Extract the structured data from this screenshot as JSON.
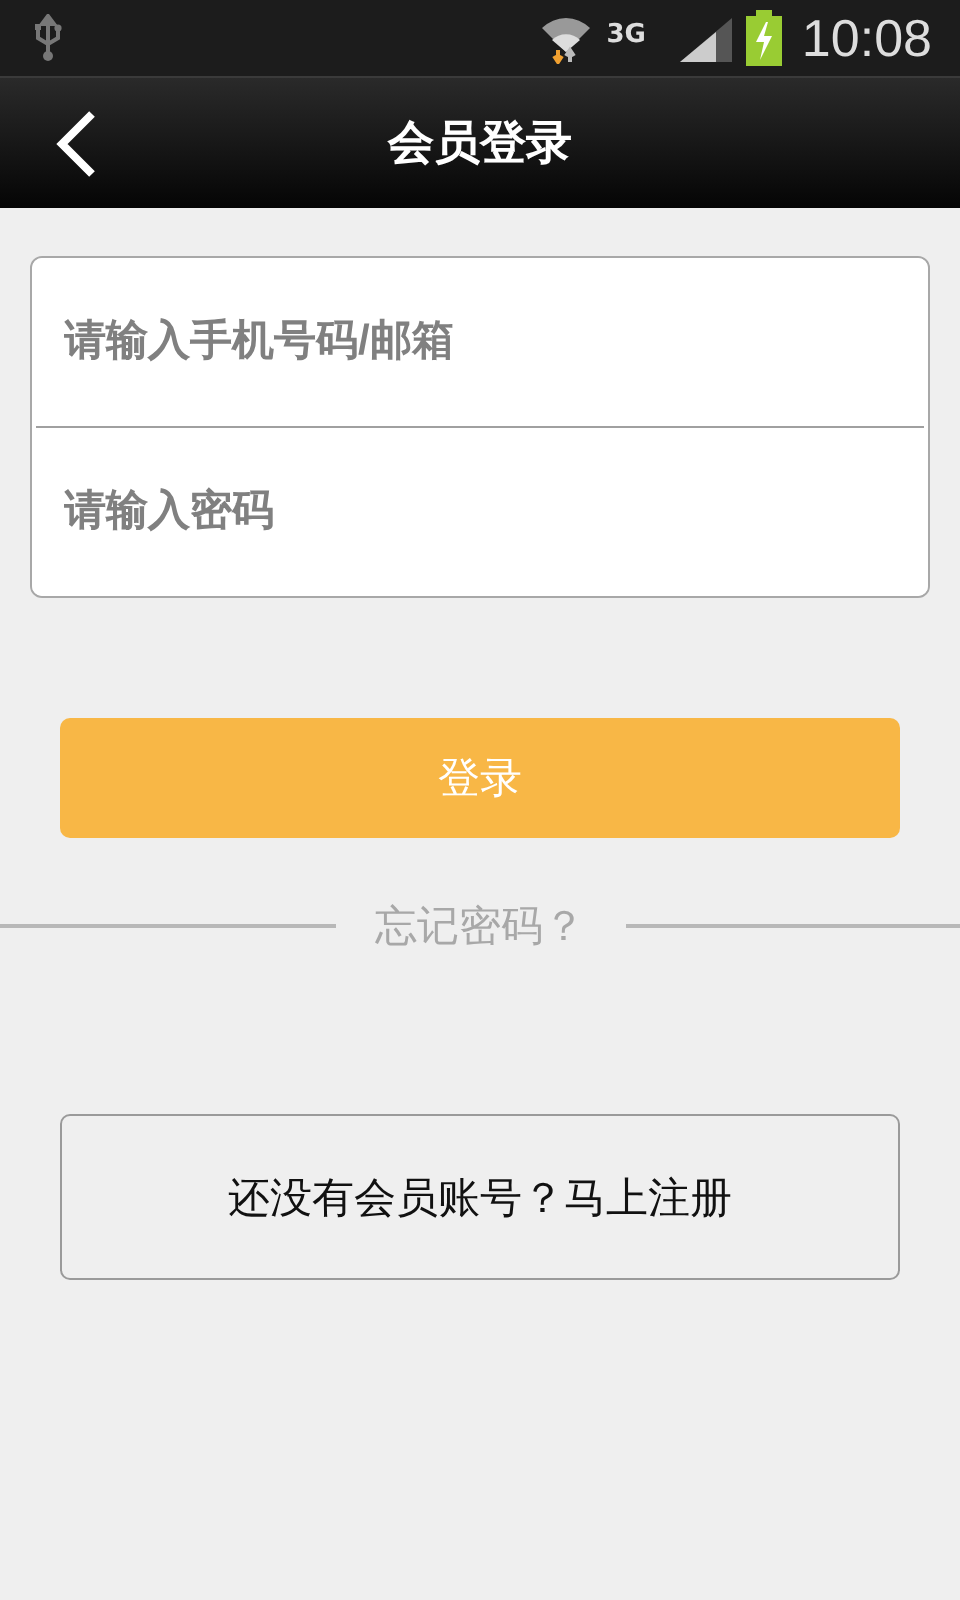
{
  "status_bar": {
    "network": "3G",
    "time": "10:08"
  },
  "header": {
    "title": "会员登录"
  },
  "form": {
    "fields": [
      {
        "placeholder": "请输入手机号码/邮箱"
      },
      {
        "placeholder": "请输入密码"
      }
    ]
  },
  "login_button": "登录",
  "forgot_password": "忘记密码？",
  "register_button": "还没有会员账号？马上注册"
}
